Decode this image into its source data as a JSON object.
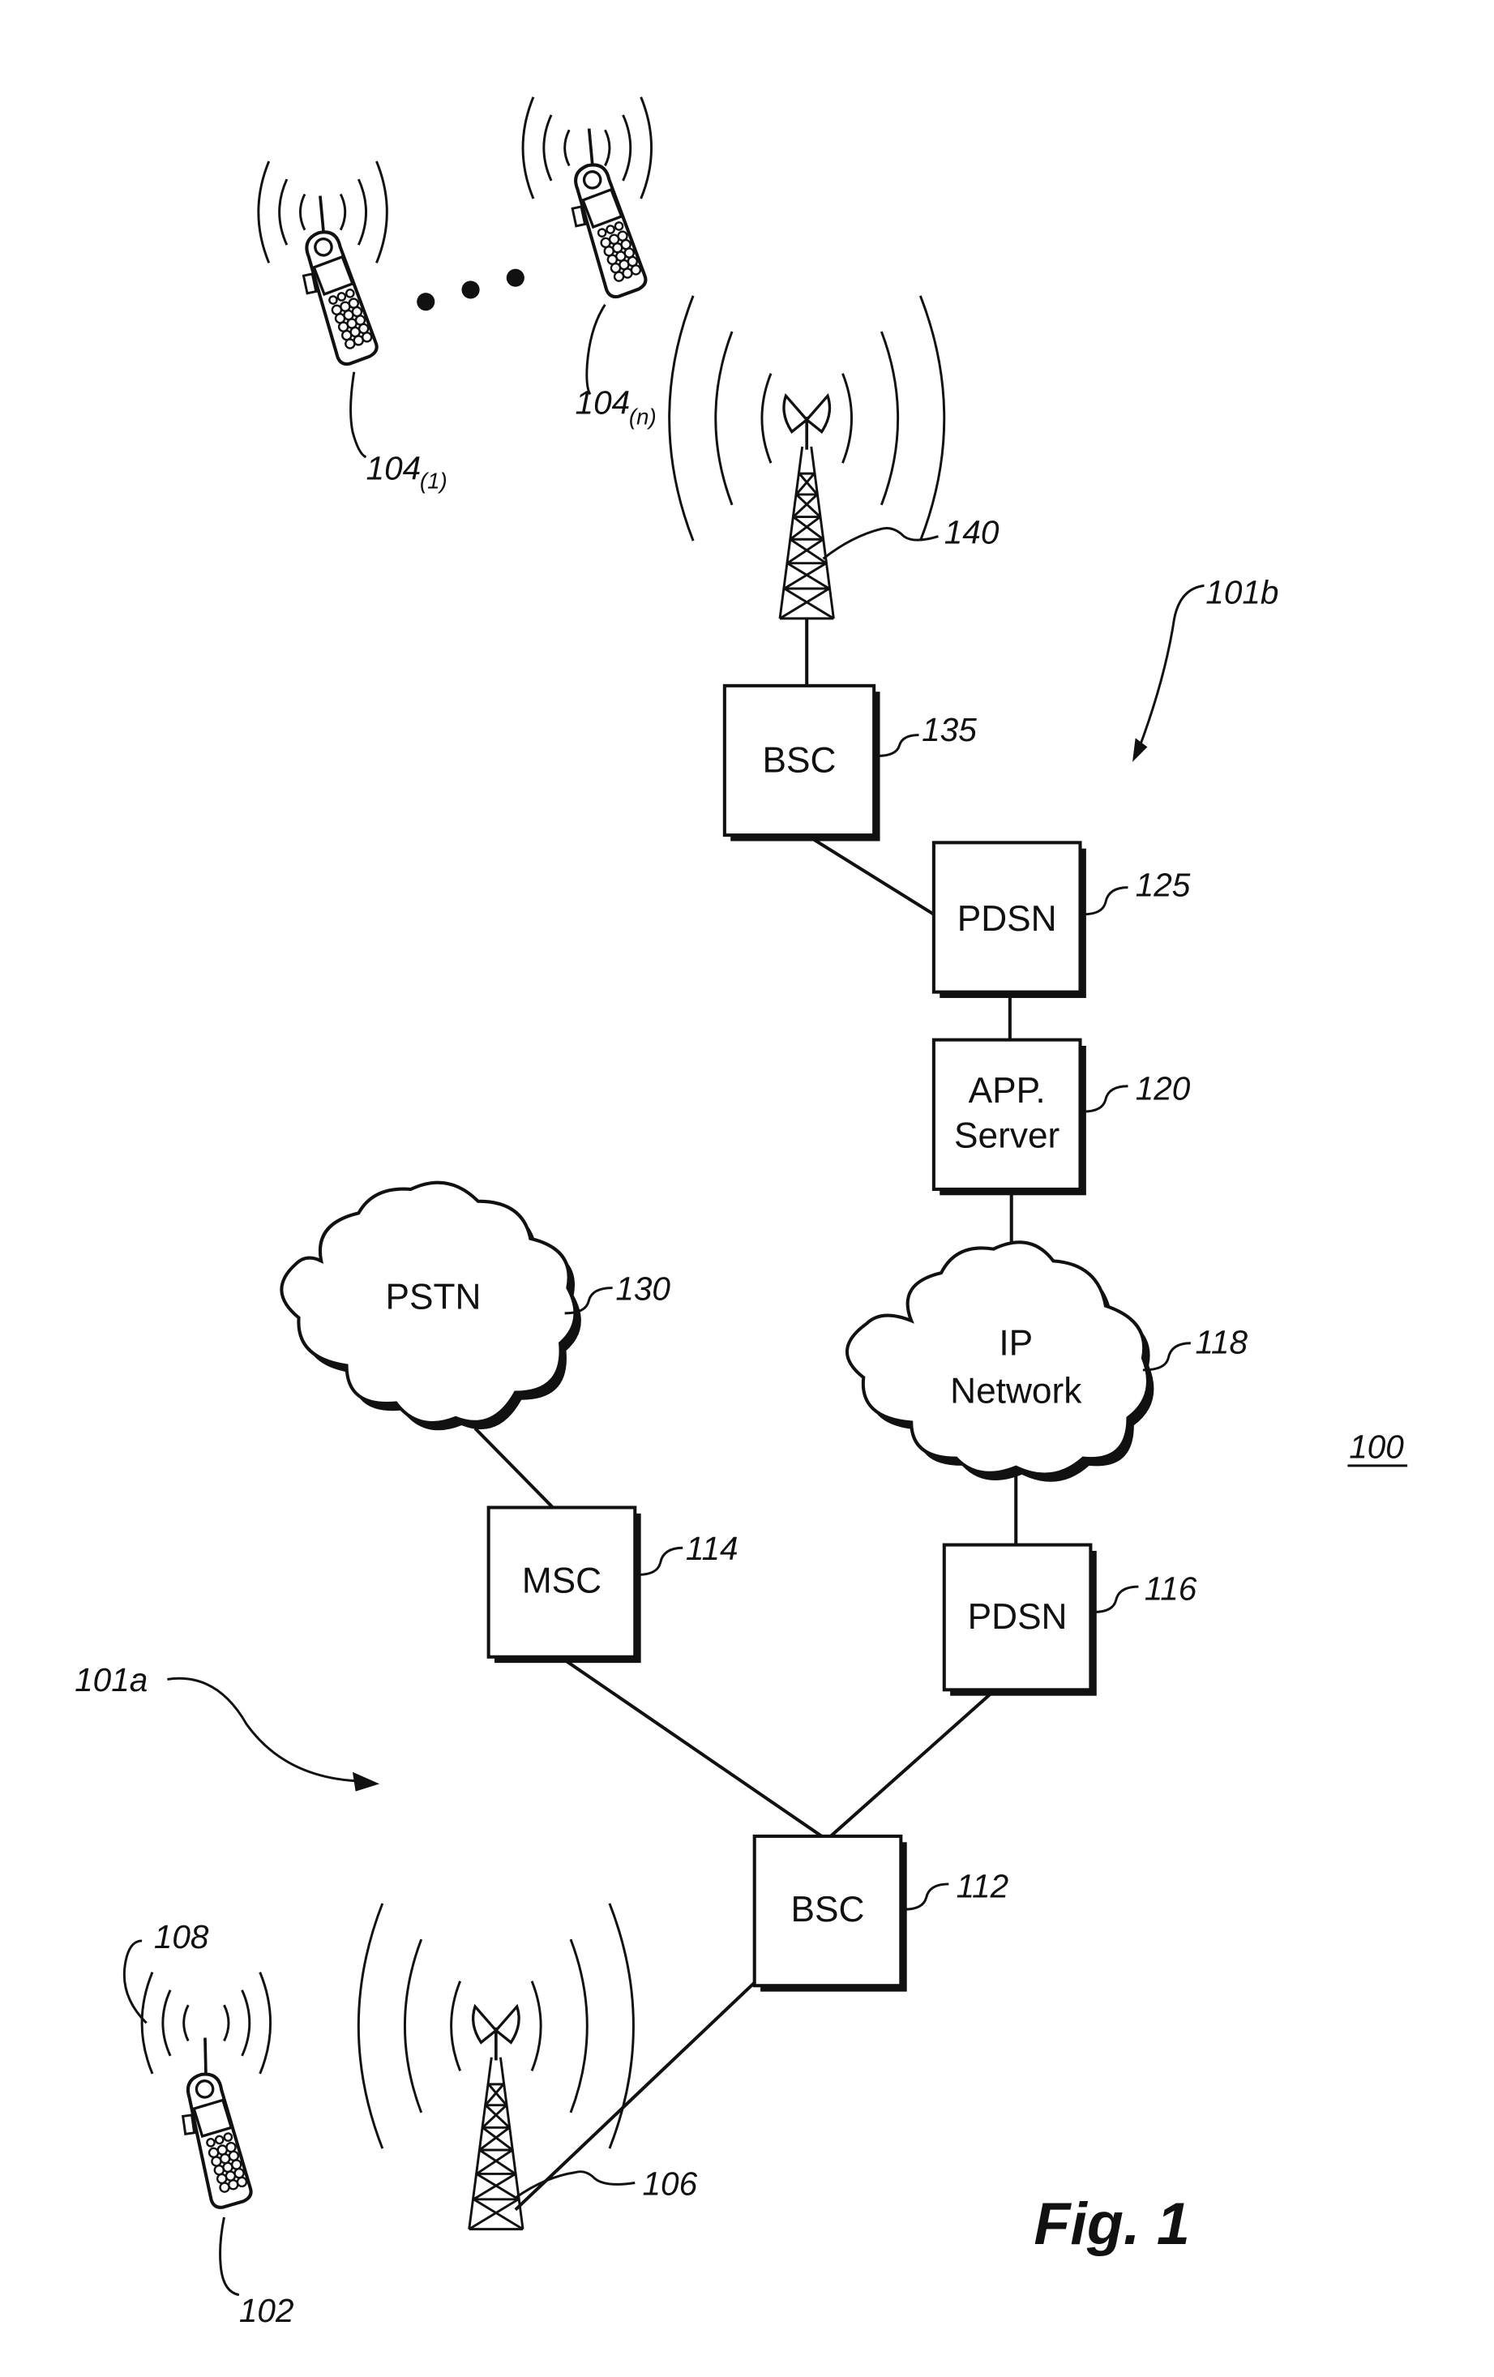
{
  "figure": {
    "title": "Fig. 1",
    "system_ref": "100"
  },
  "networks": {
    "region_a": "101a",
    "region_b": "101b"
  },
  "nodes": {
    "bsc_135": {
      "label": "BSC",
      "ref": "135"
    },
    "pdsn_125": {
      "label": "PDSN",
      "ref": "125"
    },
    "app_server_120": {
      "label_line1": "APP.",
      "label_line2": "Server",
      "ref": "120"
    },
    "ip_network_118": {
      "label_line1": "IP",
      "label_line2": "Network",
      "ref": "118"
    },
    "pstn_130": {
      "label": "PSTN",
      "ref": "130"
    },
    "msc_114": {
      "label": "MSC",
      "ref": "114"
    },
    "pdsn_116": {
      "label": "PDSN",
      "ref": "116"
    },
    "bsc_112": {
      "label": "BSC",
      "ref": "112"
    },
    "tower_140": {
      "ref": "140"
    },
    "tower_106": {
      "ref": "106"
    },
    "phone_104_1": {
      "ref": "104",
      "sub": "(1)"
    },
    "phone_104_n": {
      "ref": "104",
      "sub": "(n)"
    },
    "phone_102": {
      "ref": "102"
    },
    "signal_108": {
      "ref": "108"
    }
  }
}
